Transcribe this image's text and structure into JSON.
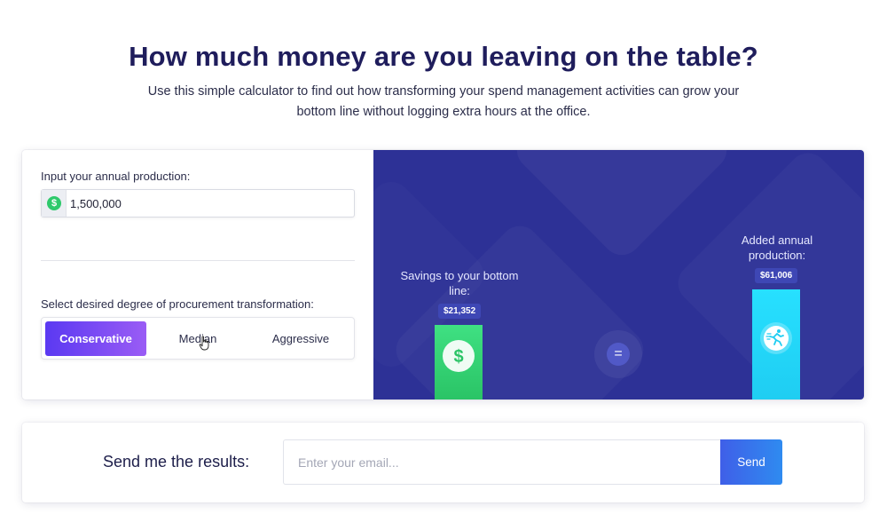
{
  "header": {
    "title": "How much money are you leaving on the table?",
    "subtitle": "Use this simple calculator to find out how transforming your spend management activities can grow your bottom line without logging extra hours at the office."
  },
  "calculator": {
    "production_label": "Input your annual production:",
    "production_value": "1,500,000",
    "currency_icon": "dollar-icon",
    "transformation_label": "Select desired degree of procurement transformation:",
    "options": [
      {
        "label": "Conservative",
        "active": true
      },
      {
        "label": "Median",
        "active": false
      },
      {
        "label": "Aggressive",
        "active": false
      }
    ]
  },
  "results": {
    "savings_label": "Savings to your bottom line:",
    "savings_value": "$21,352",
    "equals_symbol": "=",
    "added_label": "Added annual production:",
    "added_value": "$61,006",
    "colors": {
      "panel": "#2d3196",
      "savings_bar": "#3fe082",
      "added_bar": "#27e0ff",
      "accent": "#5b39f2"
    }
  },
  "email": {
    "label": "Send me the results:",
    "placeholder": "Enter your email...",
    "send_label": "Send"
  }
}
